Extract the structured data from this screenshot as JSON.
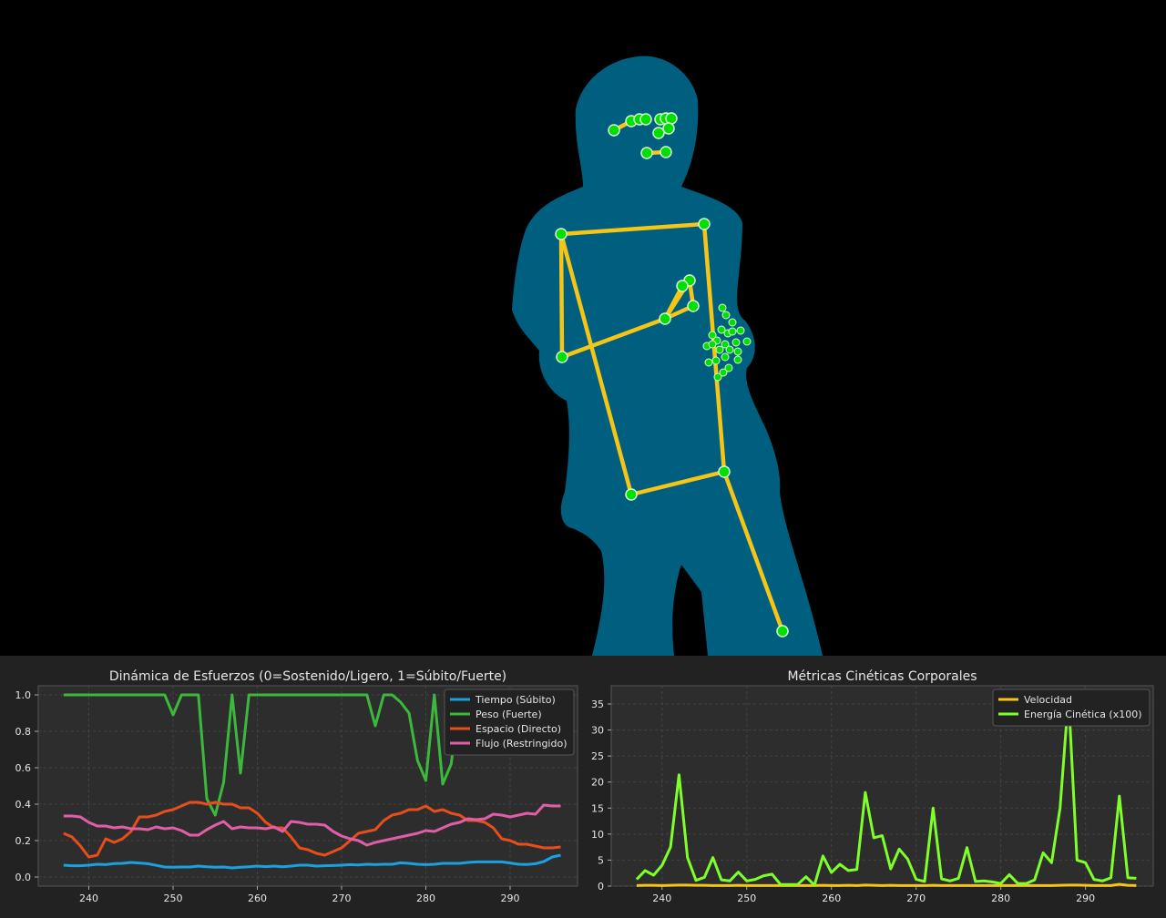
{
  "colors": {
    "silhouette": "#005f7f",
    "skeleton_line": "#f5c518",
    "keypoint_fill": "#00e000",
    "keypoint_stroke": "#d8ffd0",
    "panel_bg": "#222222",
    "axes_bg": "#2d2d2d",
    "grid": "#444444",
    "text": "#e6e6e6"
  },
  "icons": {
    "pose_view": "body-skeleton-overlay"
  },
  "chart_data": [
    {
      "type": "line",
      "title": "Dinámica de Esfuerzos (0=Sostenido/Ligero, 1=Súbito/Fuerte)",
      "xlabel": "",
      "ylabel": "",
      "xlim": [
        234,
        298
      ],
      "ylim": [
        -0.05,
        1.05
      ],
      "xticks": [
        240,
        250,
        260,
        270,
        280,
        290
      ],
      "yticks": [
        "0.0",
        "0.2",
        "0.4",
        "0.6",
        "0.8",
        "1.0"
      ],
      "grid": true,
      "legend": "top-right",
      "x": [
        237,
        238,
        239,
        240,
        241,
        242,
        243,
        244,
        245,
        246,
        247,
        248,
        249,
        250,
        251,
        252,
        253,
        254,
        255,
        256,
        257,
        258,
        259,
        260,
        261,
        262,
        263,
        264,
        265,
        266,
        267,
        268,
        269,
        270,
        271,
        272,
        273,
        274,
        275,
        276,
        277,
        278,
        279,
        280,
        281,
        282,
        283,
        284,
        285,
        286,
        287,
        288,
        289,
        290,
        291,
        292,
        293,
        294,
        295,
        296
      ],
      "series": [
        {
          "name": "Tiempo (Súbito)",
          "color": "#1ba1e2",
          "values": [
            0.065,
            0.062,
            0.062,
            0.065,
            0.07,
            0.068,
            0.074,
            0.075,
            0.08,
            0.077,
            0.073,
            0.064,
            0.055,
            0.054,
            0.055,
            0.055,
            0.06,
            0.056,
            0.054,
            0.055,
            0.05,
            0.054,
            0.056,
            0.06,
            0.057,
            0.06,
            0.056,
            0.06,
            0.065,
            0.065,
            0.06,
            0.062,
            0.063,
            0.065,
            0.068,
            0.066,
            0.07,
            0.068,
            0.07,
            0.07,
            0.078,
            0.075,
            0.07,
            0.068,
            0.07,
            0.075,
            0.075,
            0.075,
            0.08,
            0.083,
            0.083,
            0.083,
            0.083,
            0.077,
            0.07,
            0.069,
            0.073,
            0.085,
            0.11,
            0.12
          ]
        },
        {
          "name": "Peso (Fuerte)",
          "color": "#3cb83c",
          "values": [
            1.0,
            1.0,
            1.0,
            1.0,
            1.0,
            1.0,
            1.0,
            1.0,
            1.0,
            1.0,
            1.0,
            1.0,
            1.0,
            0.89,
            1.0,
            1.0,
            1.0,
            0.43,
            0.34,
            0.52,
            1.0,
            0.57,
            1.0,
            1.0,
            1.0,
            1.0,
            1.0,
            1.0,
            1.0,
            1.0,
            1.0,
            1.0,
            1.0,
            1.0,
            1.0,
            1.0,
            1.0,
            0.83,
            1.0,
            1.0,
            0.96,
            0.9,
            0.64,
            0.53,
            1.0,
            0.51,
            0.62,
            1.0,
            1.0,
            1.0,
            1.0,
            1.0,
            1.0,
            1.0,
            1.0,
            1.0,
            1.0,
            1.0,
            1.0,
            1.0
          ]
        },
        {
          "name": "Espacio (Directo)",
          "color": "#e84e1b",
          "values": [
            0.24,
            0.22,
            0.17,
            0.11,
            0.12,
            0.21,
            0.19,
            0.21,
            0.25,
            0.33,
            0.33,
            0.34,
            0.36,
            0.37,
            0.39,
            0.41,
            0.41,
            0.4,
            0.41,
            0.4,
            0.4,
            0.38,
            0.38,
            0.35,
            0.3,
            0.27,
            0.27,
            0.22,
            0.16,
            0.15,
            0.13,
            0.12,
            0.14,
            0.16,
            0.2,
            0.24,
            0.25,
            0.26,
            0.31,
            0.34,
            0.35,
            0.37,
            0.37,
            0.39,
            0.36,
            0.37,
            0.35,
            0.34,
            0.31,
            0.31,
            0.3,
            0.27,
            0.21,
            0.2,
            0.18,
            0.18,
            0.17,
            0.16,
            0.16,
            0.165
          ]
        },
        {
          "name": "Flujo (Restringido)",
          "color": "#e05ea8",
          "values": [
            0.335,
            0.335,
            0.33,
            0.3,
            0.28,
            0.28,
            0.27,
            0.275,
            0.265,
            0.265,
            0.26,
            0.275,
            0.265,
            0.27,
            0.255,
            0.23,
            0.23,
            0.26,
            0.285,
            0.305,
            0.265,
            0.275,
            0.27,
            0.27,
            0.265,
            0.275,
            0.25,
            0.305,
            0.3,
            0.29,
            0.29,
            0.285,
            0.25,
            0.225,
            0.21,
            0.2,
            0.175,
            0.19,
            0.2,
            0.21,
            0.22,
            0.23,
            0.24,
            0.255,
            0.25,
            0.27,
            0.29,
            0.3,
            0.32,
            0.315,
            0.32,
            0.345,
            0.34,
            0.33,
            0.34,
            0.35,
            0.345,
            0.395,
            0.39,
            0.39
          ]
        }
      ]
    },
    {
      "type": "line",
      "title": "Métricas Cinéticas Corporales",
      "xlabel": "",
      "ylabel": "",
      "xlim": [
        234,
        298
      ],
      "ylim": [
        0,
        38.5
      ],
      "xticks": [
        240,
        250,
        260,
        270,
        280,
        290
      ],
      "yticks": [
        "0",
        "5",
        "10",
        "15",
        "20",
        "25",
        "30",
        "35"
      ],
      "grid": true,
      "legend": "top-right",
      "x": [
        237,
        238,
        239,
        240,
        241,
        242,
        243,
        244,
        245,
        246,
        247,
        248,
        249,
        250,
        251,
        252,
        253,
        254,
        255,
        256,
        257,
        258,
        259,
        260,
        261,
        262,
        263,
        264,
        265,
        266,
        267,
        268,
        269,
        270,
        271,
        272,
        273,
        274,
        275,
        276,
        277,
        278,
        279,
        280,
        281,
        282,
        283,
        284,
        285,
        286,
        287,
        288,
        289,
        290,
        291,
        292,
        293,
        294,
        295,
        296
      ],
      "series": [
        {
          "name": "Velocidad",
          "color": "#f5c518",
          "values": [
            0.1,
            0.15,
            0.15,
            0.1,
            0.15,
            0.2,
            0.2,
            0.15,
            0.15,
            0.1,
            0.1,
            0.1,
            0.15,
            0.1,
            0.1,
            0.1,
            0.1,
            0.1,
            0.1,
            0.1,
            0.1,
            0.1,
            0.15,
            0.1,
            0.1,
            0.15,
            0.1,
            0.2,
            0.15,
            0.1,
            0.15,
            0.1,
            0.1,
            0.1,
            0.1,
            0.15,
            0.1,
            0.1,
            0.1,
            0.1,
            0.1,
            0.1,
            0.1,
            0.1,
            0.1,
            0.1,
            0.1,
            0.1,
            0.1,
            0.1,
            0.15,
            0.2,
            0.2,
            0.15,
            0.1,
            0.1,
            0.1,
            0.35,
            0.15,
            0.1
          ]
        },
        {
          "name": "Energía Cinética (x100)",
          "color": "#7fff2a",
          "values": [
            1.3,
            3.0,
            2.1,
            4.0,
            7.5,
            21.4,
            5.5,
            1.1,
            1.7,
            5.5,
            1.2,
            1.0,
            2.7,
            1.0,
            1.3,
            2.0,
            2.3,
            0.3,
            0.3,
            0.3,
            1.8,
            0.2,
            5.8,
            2.6,
            4.2,
            3.0,
            3.2,
            18.0,
            9.3,
            9.7,
            3.3,
            7.1,
            5.2,
            1.3,
            0.9,
            15.0,
            1.4,
            1.0,
            1.5,
            7.4,
            0.9,
            1.0,
            0.8,
            0.5,
            2.2,
            0.5,
            0.5,
            1.2,
            6.4,
            4.5,
            15.0,
            36.5,
            5.0,
            4.5,
            1.3,
            1.0,
            1.6,
            17.3,
            1.6,
            1.5
          ]
        }
      ]
    }
  ]
}
